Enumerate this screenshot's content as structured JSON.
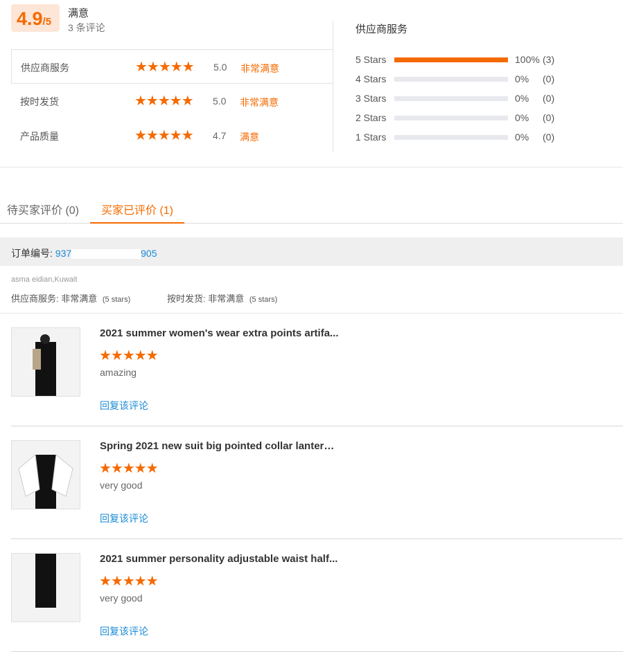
{
  "summary": {
    "score": "4.9",
    "out_of": "/5",
    "label": "满意",
    "count": "3 条评论"
  },
  "ratings": [
    {
      "label": "供应商服务",
      "stars": "★★★★★",
      "value": "5.0",
      "text": "非常满意"
    },
    {
      "label": "按时发货",
      "stars": "★★★★★",
      "value": "5.0",
      "text": "非常满意"
    },
    {
      "label": "产品质量",
      "stars": "★★★★★",
      "value": "4.7",
      "text": "满意"
    }
  ],
  "breakdown": {
    "title": "供应商服务",
    "rows": [
      {
        "label": "5 Stars",
        "percent": 100,
        "pct": "100%",
        "count": "(3)"
      },
      {
        "label": "4 Stars",
        "percent": 0,
        "pct": "0%",
        "count": "(0)"
      },
      {
        "label": "3 Stars",
        "percent": 0,
        "pct": "0%",
        "count": "(0)"
      },
      {
        "label": "2 Stars",
        "percent": 0,
        "pct": "0%",
        "count": "(0)"
      },
      {
        "label": "1 Stars",
        "percent": 0,
        "pct": "0%",
        "count": "(0)"
      }
    ]
  },
  "tabs": [
    "待买家评价 (0)",
    "买家已评价 (1)"
  ],
  "order": {
    "label": "订单编号:",
    "number_start": "937",
    "number_end": "905"
  },
  "buyer": {
    "name": "asma eidian,Kuwait",
    "r1_label": "供应商服务:",
    "r1_text": "非常满意",
    "r1_stars": "(5 stars)",
    "r2_label": "按时发货:",
    "r2_text": "非常满意",
    "r2_stars": "(5 stars)"
  },
  "items": [
    {
      "title": "2021 summer women's wear extra points artifa...",
      "stars": "★★★★★",
      "comment": "amazing",
      "reply": "回复该评论"
    },
    {
      "title": "Spring 2021 new suit big pointed collar lantern ...",
      "stars": "★★★★★",
      "comment": "very good",
      "reply": "回复该评论"
    },
    {
      "title": "2021 summer personality adjustable waist half...",
      "stars": "★★★★★",
      "comment": "very good",
      "reply": "回复该评论"
    }
  ]
}
